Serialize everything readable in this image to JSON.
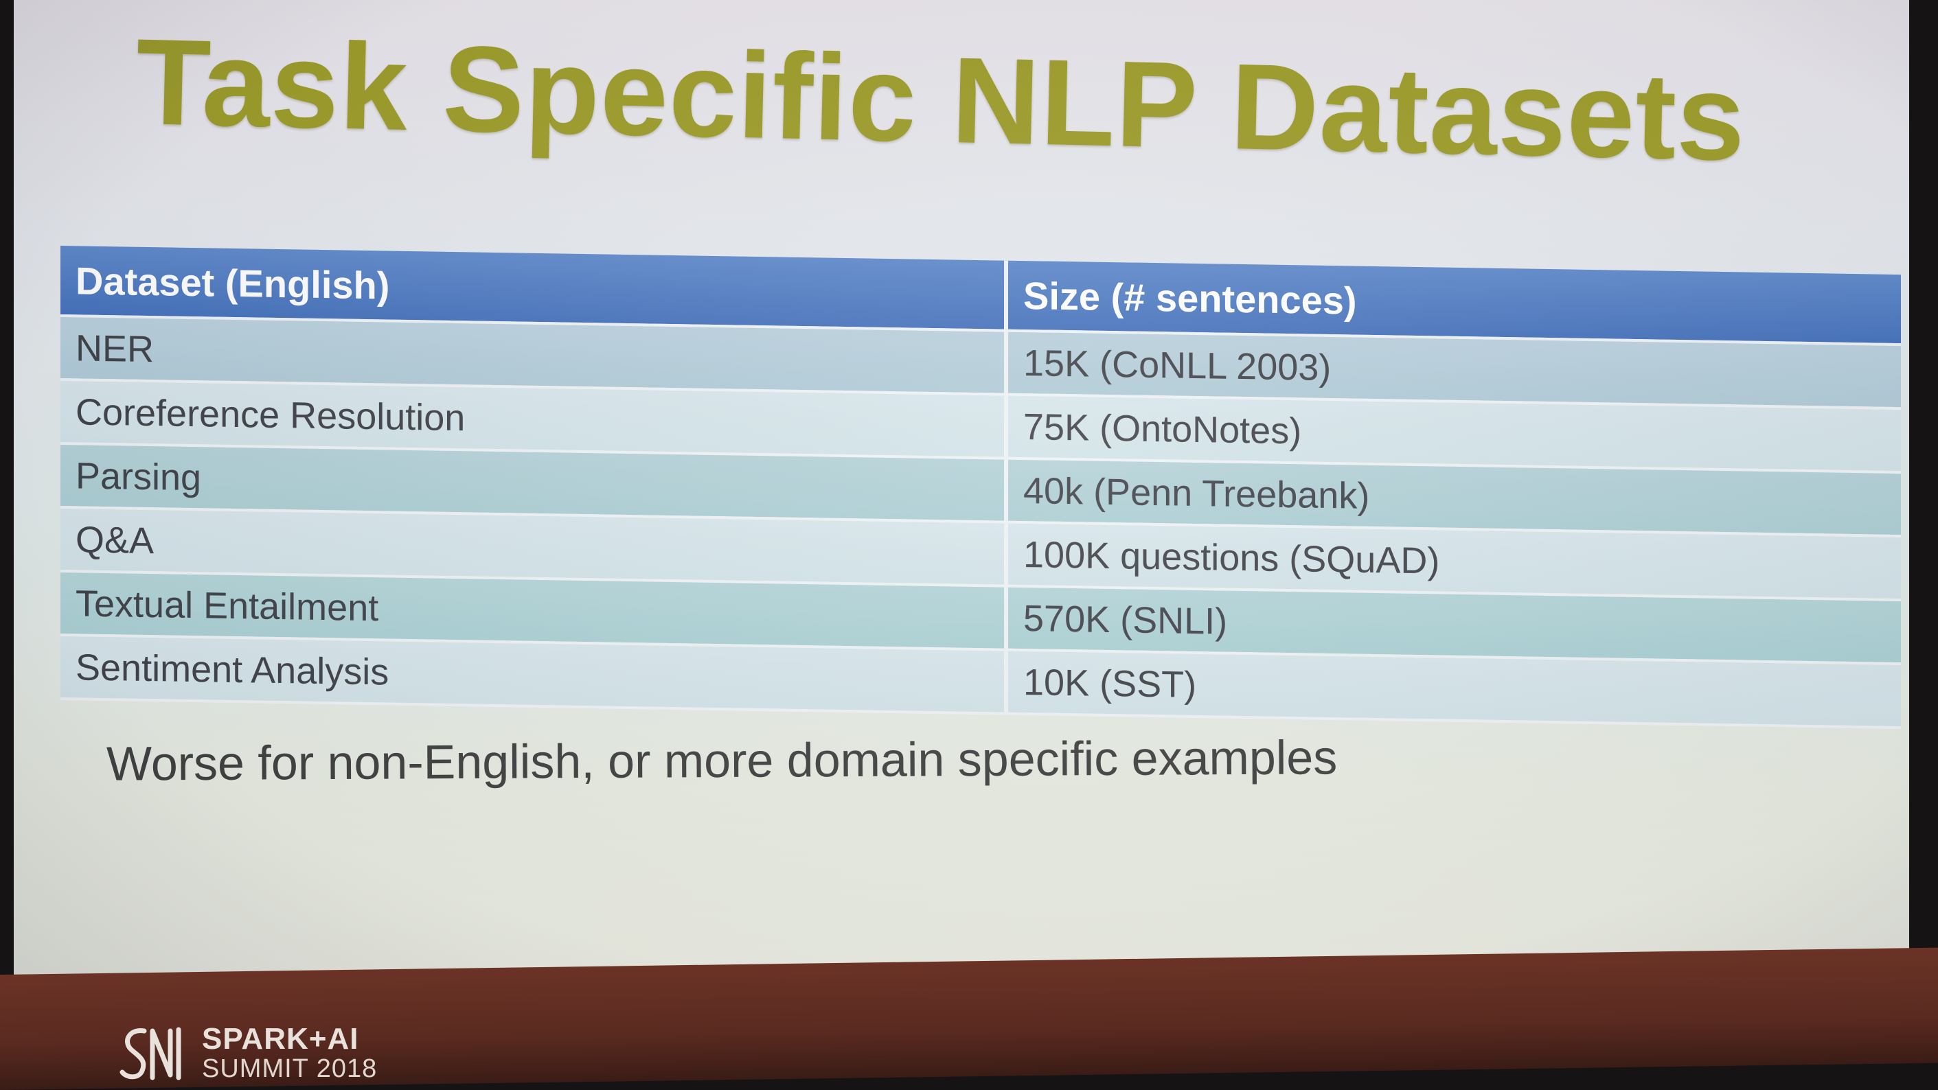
{
  "slide": {
    "title": "Task Specific NLP Datasets",
    "note": "Worse for non-English, or more domain specific examples"
  },
  "table": {
    "headers": [
      "Dataset (English)",
      "Size (# sentences)"
    ],
    "rows": [
      [
        "NER",
        "15K (CoNLL 2003)"
      ],
      [
        "Coreference Resolution",
        "75K (OntoNotes)"
      ],
      [
        "Parsing",
        "40k (Penn Treebank)"
      ],
      [
        "Q&A",
        "100K questions (SQuAD)"
      ],
      [
        "Textual Entailment",
        "570K (SNLI)"
      ],
      [
        "Sentiment Analysis",
        "10K (SST)"
      ]
    ]
  },
  "footer": {
    "logo_line1": "SPARK+AI",
    "logo_line2": "SUMMIT 2018"
  },
  "colors": {
    "title": "#9a9a22",
    "header_bg": "#4a78c0",
    "row_dark": "#b4cdd9",
    "row_light": "#d4e4e8",
    "footer_bg": "#5e2d22"
  }
}
